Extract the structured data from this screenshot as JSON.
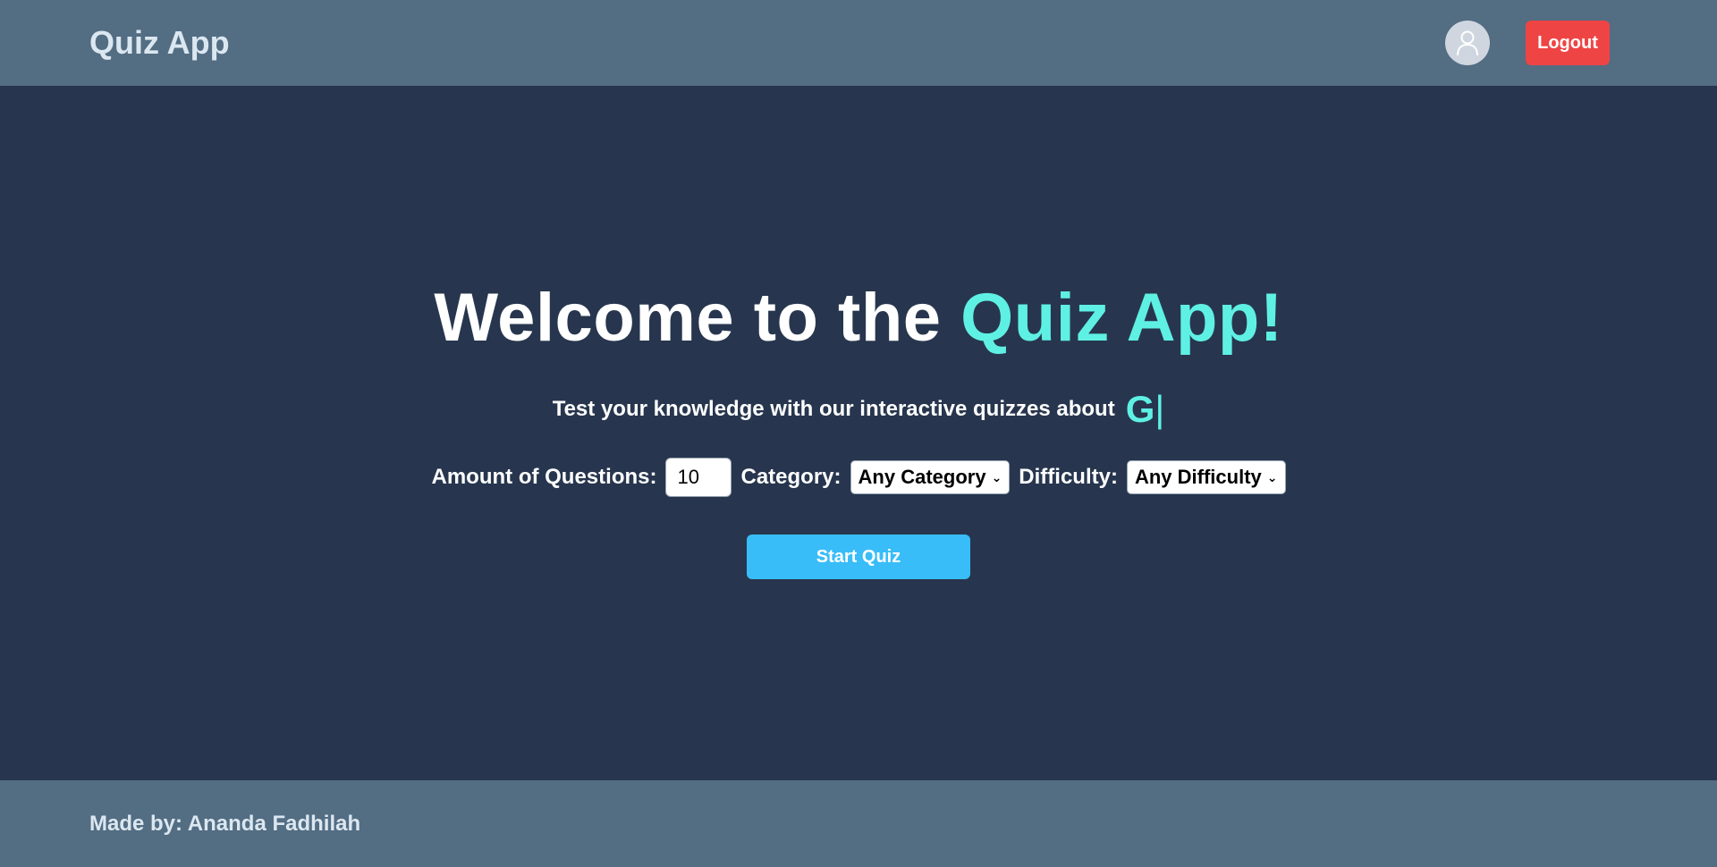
{
  "navbar": {
    "brand": "Quiz App",
    "avatar_icon": "user-icon",
    "logout_label": "Logout"
  },
  "hero": {
    "headline_prefix": "Welcome to the ",
    "headline_accent": "Quiz App!",
    "subline": "Test your knowledge with our interactive quizzes about",
    "typed_text": "G",
    "typed_cursor": "|"
  },
  "form": {
    "amount_label": "Amount of Questions:",
    "amount_value": "10",
    "category_label": "Category:",
    "category_selected": "Any Category",
    "difficulty_label": "Difficulty:",
    "difficulty_selected": "Any Difficulty",
    "start_label": "Start Quiz"
  },
  "footer": {
    "text": "Made by: Ananda Fadhilah"
  },
  "colors": {
    "navbar_bg": "#536d83",
    "page_bg": "#27364e",
    "accent": "#5ff0e4",
    "logout_bg": "#ef4444",
    "start_bg": "#38bdf8"
  }
}
